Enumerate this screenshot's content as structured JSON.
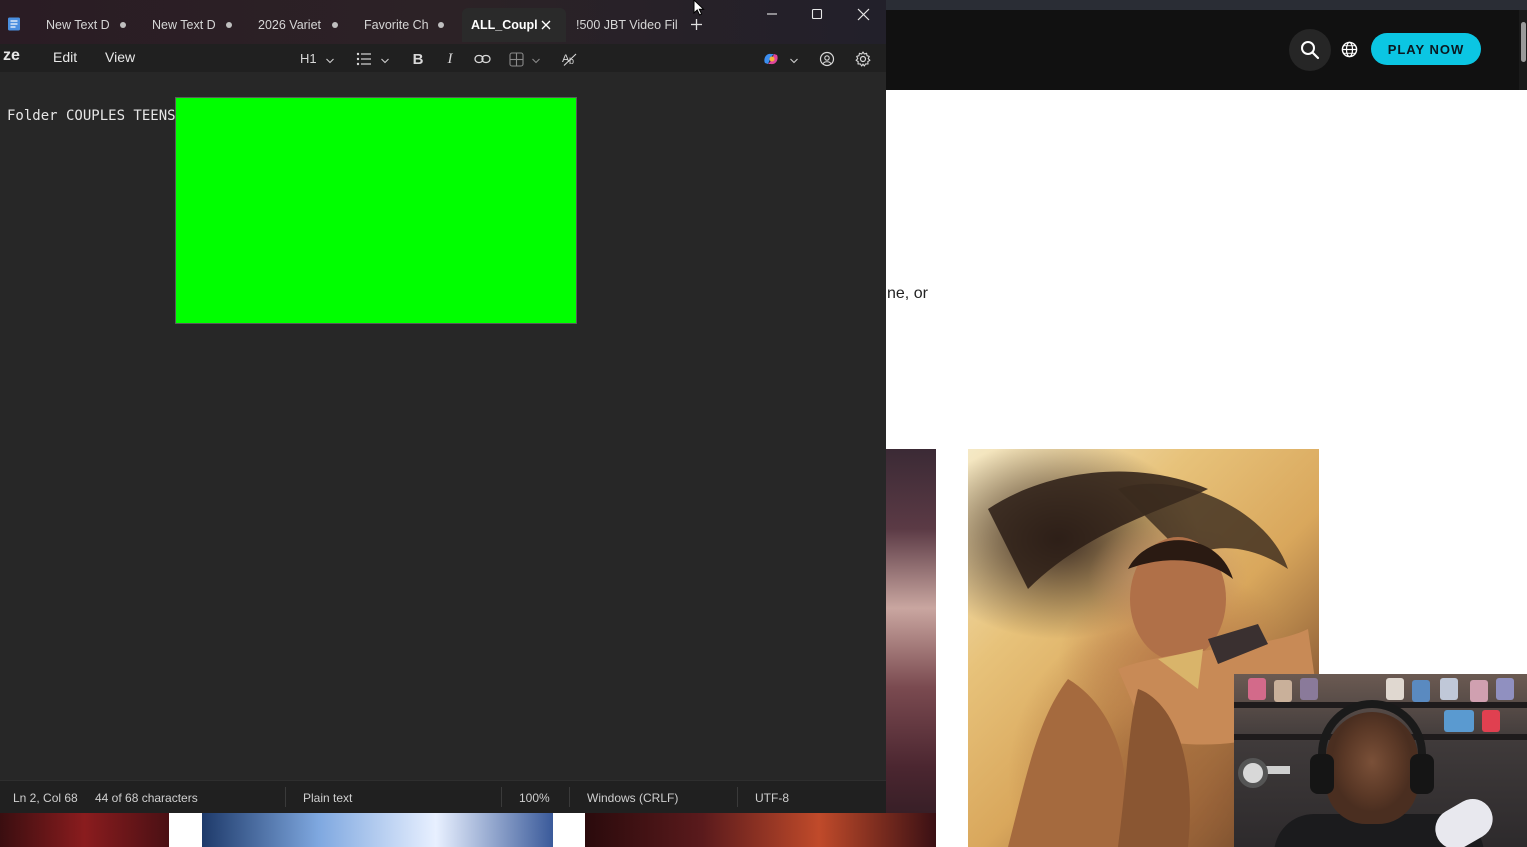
{
  "web": {
    "play_now_label": "PLAY NOW",
    "body_text_fragment": "ne, or",
    "accent": "#0bc6e3"
  },
  "notepad": {
    "app_name": "Notepad",
    "tabs": [
      {
        "label": "New Text D",
        "modified": true,
        "active": false
      },
      {
        "label": "New Text D",
        "modified": true,
        "active": false
      },
      {
        "label": "2026 Variet",
        "modified": true,
        "active": false
      },
      {
        "label": "Favorite Ch",
        "modified": true,
        "active": false
      },
      {
        "label": "ALL_Coupl",
        "modified": false,
        "active": true
      },
      {
        "label": "!500 JBT Video Fil",
        "modified": false,
        "active": false
      }
    ],
    "menu": {
      "file_label": "ze",
      "edit_label": "Edit",
      "view_label": "View"
    },
    "toolbar": {
      "heading_label": "H1",
      "bold_label": "B",
      "italic_label": "I",
      "icons": [
        "list-icon",
        "link-icon",
        "table-icon",
        "spellcheck-icon",
        "copilot-icon",
        "account-icon",
        "gear-icon"
      ]
    },
    "editor": {
      "text": "Folder COUPLES TEENS ",
      "image_color": "#00ff00"
    },
    "status": {
      "position": "Ln 2, Col 68",
      "characters": "44 of 68 characters",
      "format": "Plain text",
      "zoom": "100%",
      "line_ending": "Windows (CRLF)",
      "encoding": "UTF-8"
    }
  }
}
